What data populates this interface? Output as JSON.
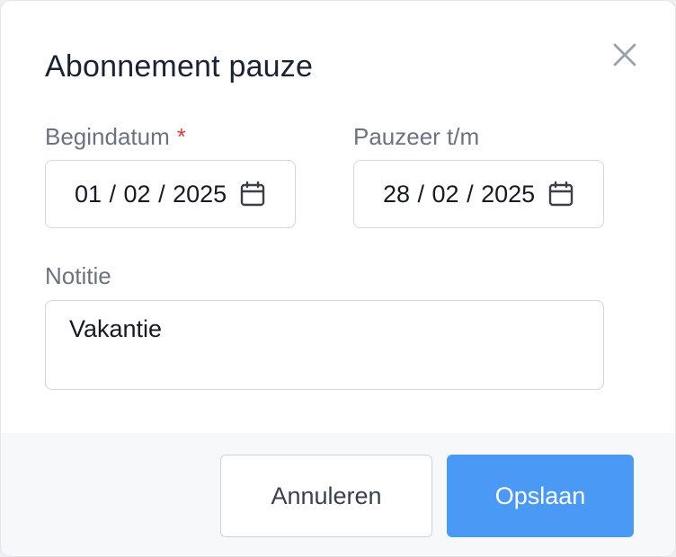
{
  "dialog": {
    "title": "Abonnement pauze",
    "close_icon": "close-icon"
  },
  "form": {
    "start_date": {
      "label": "Begindatum",
      "required_marker": "*",
      "value": "01 / 02 / 2025",
      "icon": "calendar-icon"
    },
    "end_date": {
      "label": "Pauzeer t/m",
      "value": "28 / 02 / 2025",
      "icon": "calendar-icon"
    },
    "note": {
      "label": "Notitie",
      "value": "Vakantie"
    }
  },
  "footer": {
    "cancel_label": "Annuleren",
    "save_label": "Opslaan"
  },
  "colors": {
    "primary": "#4a9af5",
    "required": "#e23b3b",
    "title": "#1a2233",
    "label": "#6b7280"
  }
}
